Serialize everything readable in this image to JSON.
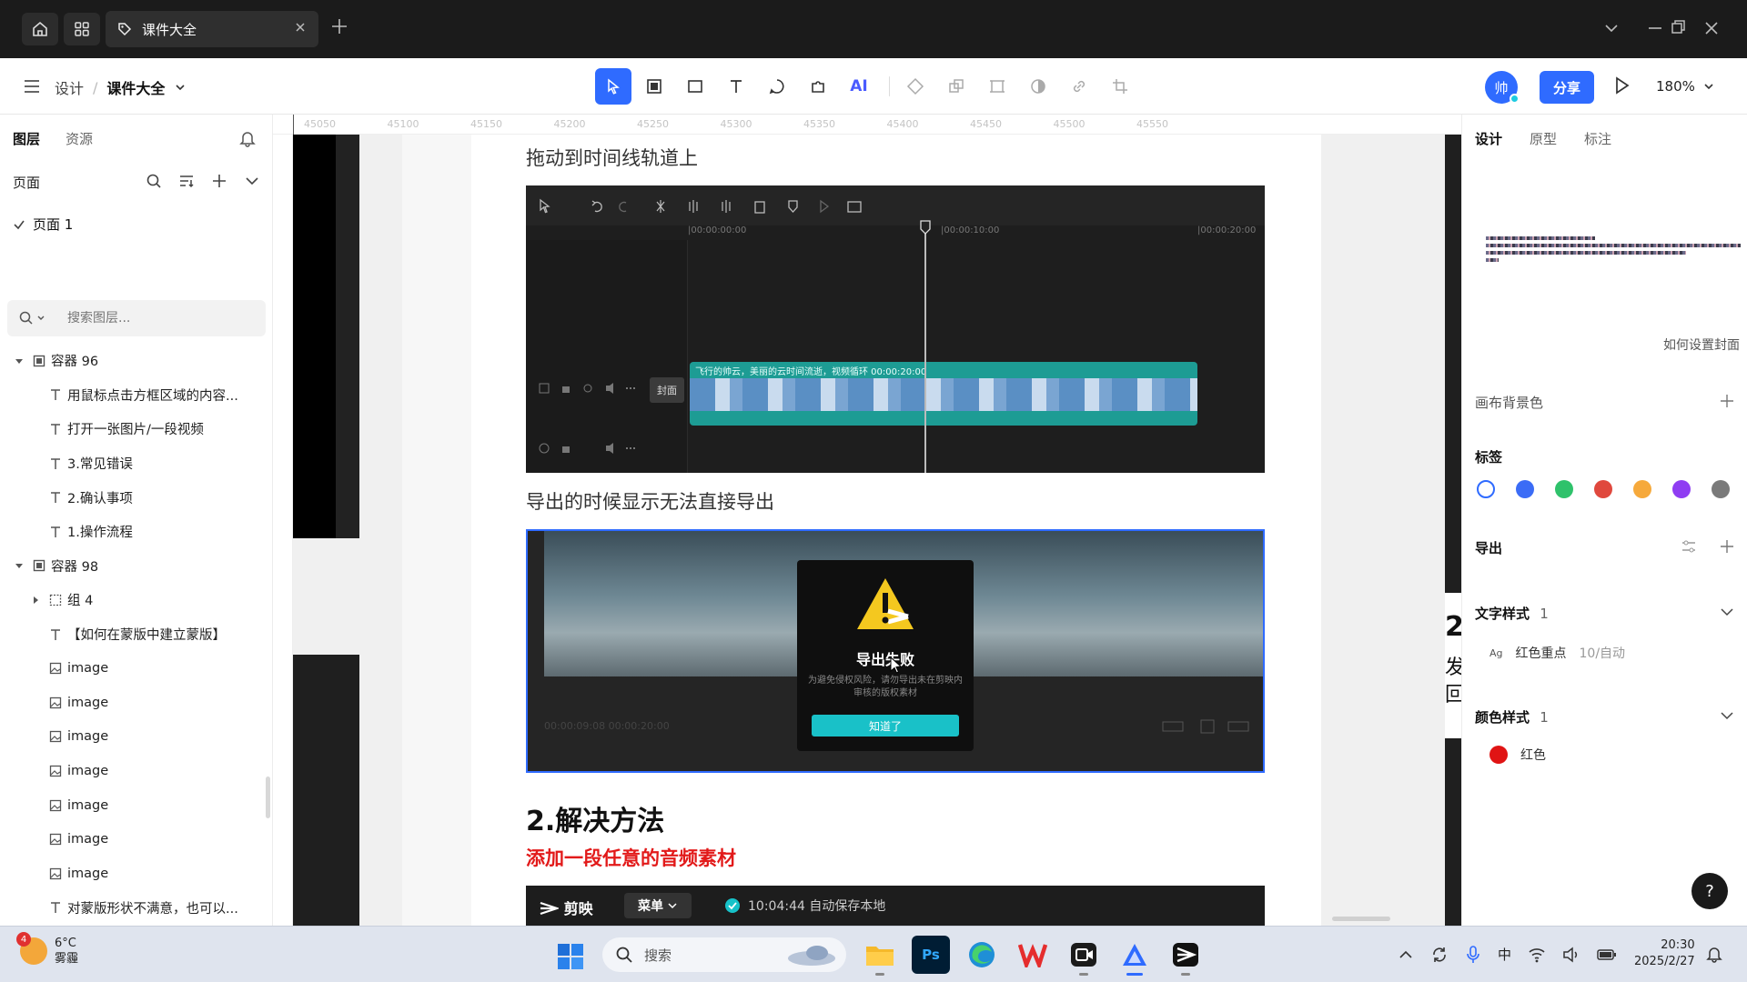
{
  "window": {
    "tab_title": "课件大全"
  },
  "toolbar": {
    "breadcrumb_root": "设计",
    "breadcrumb_sep": "/",
    "file_name": "课件大全",
    "ai_label": "AI",
    "avatar_text": "帅",
    "share_label": "分享",
    "zoom": "180%"
  },
  "left_panel": {
    "tabs": [
      "图层",
      "资源"
    ],
    "pages_label": "页面",
    "page_item": "页面 1",
    "search_placeholder": "搜索图层...",
    "layers": [
      {
        "indent": 0,
        "caret": "down",
        "icon": "frame",
        "label": "容器 96"
      },
      {
        "indent": 1,
        "caret": "",
        "icon": "text",
        "label": "用鼠标点击方框区域的内容..."
      },
      {
        "indent": 1,
        "caret": "",
        "icon": "text",
        "label": "打开一张图片/一段视频"
      },
      {
        "indent": 1,
        "caret": "",
        "icon": "text",
        "label": "3.常见错误"
      },
      {
        "indent": 1,
        "caret": "",
        "icon": "text",
        "label": "2.确认事项"
      },
      {
        "indent": 1,
        "caret": "",
        "icon": "text",
        "label": "1.操作流程"
      },
      {
        "indent": 0,
        "caret": "down",
        "icon": "frame",
        "label": "容器 98"
      },
      {
        "indent": 1,
        "caret": "right",
        "icon": "group",
        "label": "组 4"
      },
      {
        "indent": 1,
        "caret": "",
        "icon": "text",
        "label": "【如何在蒙版中建立蒙版】"
      },
      {
        "indent": 1,
        "caret": "",
        "icon": "image",
        "label": "image"
      },
      {
        "indent": 1,
        "caret": "",
        "icon": "image",
        "label": "image"
      },
      {
        "indent": 1,
        "caret": "",
        "icon": "image",
        "label": "image"
      },
      {
        "indent": 1,
        "caret": "",
        "icon": "image",
        "label": "image"
      },
      {
        "indent": 1,
        "caret": "",
        "icon": "image",
        "label": "image"
      },
      {
        "indent": 1,
        "caret": "",
        "icon": "image",
        "label": "image"
      },
      {
        "indent": 1,
        "caret": "",
        "icon": "image",
        "label": "image"
      },
      {
        "indent": 1,
        "caret": "",
        "icon": "text",
        "label": "对蒙版形状不满意，也可以..."
      }
    ]
  },
  "canvas": {
    "ruler_ticks": [
      "45050",
      "45100",
      "45150",
      "45200",
      "45250",
      "45300",
      "45350",
      "45400",
      "45450",
      "45500",
      "45550"
    ],
    "heading1": "拖动到时间线轨道上",
    "timeline": {
      "ticks": [
        "|00:00:00:00",
        "|00:00:10:00",
        "|00:00:20:00"
      ],
      "clip_caption": "飞行的帅云，美丽的云时间流逝，视频循环  00:00:20:00",
      "cover_label": "封面"
    },
    "heading2": "导出的时候显示无法直接导出",
    "export_dialog": {
      "title": "导出失败",
      "message": "为避免侵权风险，请勿导出未在剪映内审核的版权素材",
      "ok_label": "知道了",
      "timecode": "00:00:09:08    00:00:20:00"
    },
    "section_title": "2.解决方法",
    "red_note": "添加一段任意的音频素材",
    "capcut_bar": {
      "logo": "剪映",
      "menu": "菜单",
      "saved": "10:04:44 自动保存本地"
    },
    "peek_texts": [
      "2",
      "发",
      "回"
    ]
  },
  "right_panel": {
    "tabs": [
      "设计",
      "原型",
      "标注"
    ],
    "cover_link": "如何设置封面",
    "canvas_bg_label": "画布背景色",
    "tags_label": "标签",
    "tag_colors": [
      "#ffffff",
      "#3b6cf6",
      "#2fc26b",
      "#e0483d",
      "#f6a93b",
      "#8f3df2",
      "#7a7a7a"
    ],
    "export_label": "导出",
    "text_style_label": "文字样式",
    "text_style_count": "1",
    "text_style_name": "红色重点",
    "text_style_meta": "10/自动",
    "text_style_glyph": "Ag",
    "color_style_label": "颜色样式",
    "color_style_count": "1",
    "color_style_name": "红色",
    "color_style_hex": "#e01414",
    "help_label": "?"
  },
  "taskbar": {
    "weather_badge": "4",
    "temperature": "6°C",
    "weather_desc": "雾霾",
    "search_placeholder": "搜索",
    "apps": [
      "files-app",
      "ps-app",
      "edge-app",
      "wps-app",
      "screen-recorder-app",
      "pixso-app",
      "capcut-app"
    ],
    "ps_label": "Ps",
    "ime": "中",
    "time": "20:30",
    "date": "2025/2/27"
  }
}
